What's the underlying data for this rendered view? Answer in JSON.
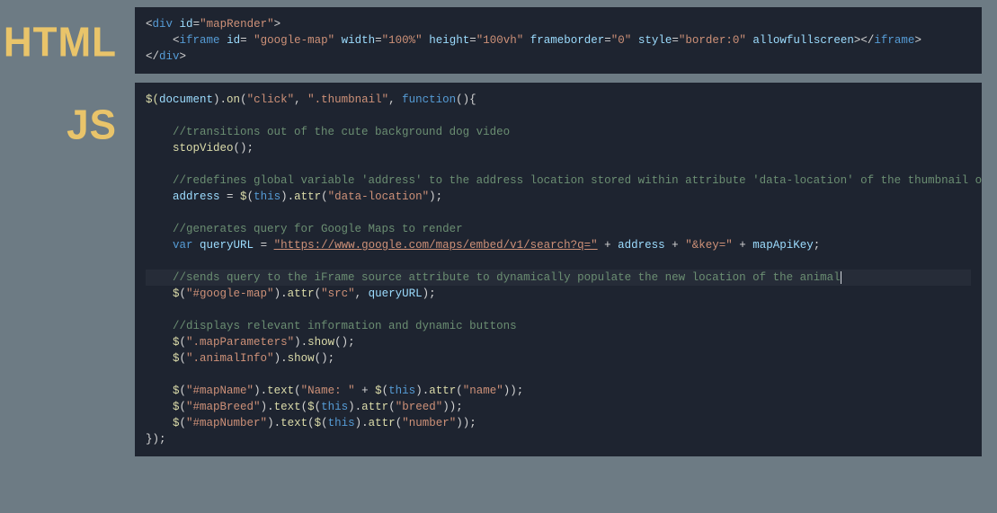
{
  "labels": {
    "html": "HTML",
    "js": "JS"
  },
  "html_code": {
    "l1": {
      "open": "<",
      "tag": "div",
      "sp": " ",
      "attr1": "id",
      "eq": "=",
      "val1": "\"mapRender\"",
      "close": ">"
    },
    "l2": {
      "indent": "    ",
      "open": "<",
      "tag": "iframe",
      "sp": " ",
      "a1": "id",
      "eq1": "= ",
      "v1": "\"google-map\"",
      "sp2": " ",
      "a2": "width",
      "eq2": "=",
      "v2": "\"100%\"",
      "sp3": " ",
      "a3": "height",
      "eq3": "=",
      "v3": "\"100vh\"",
      "sp4": " ",
      "a4": "frameborder",
      "eq4": "=",
      "v4": "\"0\"",
      "sp5": " ",
      "a5": "style",
      "eq5": "=",
      "v5": "\"border:0\"",
      "sp6": " ",
      "a6": "allowfullscreen",
      "closeself": "></",
      "tag2": "iframe",
      "close2": ">"
    },
    "l3": {
      "open": "</",
      "tag": "div",
      "close": ">"
    }
  },
  "js_code": {
    "l1": {
      "p1": "$(",
      "v": "document",
      "p2": ").",
      "f": "on",
      "p3": "(",
      "s1": "\"click\"",
      "c1": ", ",
      "s2": "\".thumbnail\"",
      "c2": ", ",
      "kw": "function",
      "p4": "(){"
    },
    "l3": {
      "indent": "    ",
      "c": "//transitions out of the cute background dog video"
    },
    "l4": {
      "indent": "    ",
      "f": "stopVideo",
      "p": "();"
    },
    "l6": {
      "indent": "    ",
      "c": "//redefines global variable 'address' to the address location stored within attribute 'data-location' of the thumbnail of the animal"
    },
    "l7": {
      "indent": "    ",
      "v": "address",
      "eq": " = ",
      "f1": "$",
      "p1": "(",
      "kw": "this",
      "p2": ").",
      "f2": "attr",
      "p3": "(",
      "s": "\"data-location\"",
      "p4": ");"
    },
    "l9": {
      "indent": "    ",
      "c": "//generates query for Google Maps to render"
    },
    "l10": {
      "indent": "    ",
      "kw": "var",
      "sp": " ",
      "v": "queryURL",
      "eq": " = ",
      "s1": "\"https://www.google.com/maps/embed/v1/search?q=\"",
      "p1": " + ",
      "v2": "address",
      "p2": " + ",
      "s2": "\"&key=\"",
      "p3": " + ",
      "v3": "mapApiKey",
      "end": ";"
    },
    "l12": {
      "indent": "    ",
      "c": "//sends query to the iFrame source attribute to dynamically populate the new location of the animal"
    },
    "l13": {
      "indent": "    ",
      "f1": "$",
      "p1": "(",
      "s1": "\"#google-map\"",
      "p2": ").",
      "f2": "attr",
      "p3": "(",
      "s2": "\"src\"",
      "c1": ", ",
      "v": "queryURL",
      "p4": ");"
    },
    "l15": {
      "indent": "    ",
      "c": "//displays relevant information and dynamic buttons"
    },
    "l16": {
      "indent": "    ",
      "f1": "$",
      "p1": "(",
      "s1": "\".mapParameters\"",
      "p2": ").",
      "f2": "show",
      "p3": "();"
    },
    "l17": {
      "indent": "    ",
      "f1": "$",
      "p1": "(",
      "s1": "\".animalInfo\"",
      "p2": ").",
      "f2": "show",
      "p3": "();"
    },
    "l19": {
      "indent": "    ",
      "f1": "$",
      "p1": "(",
      "s1": "\"#mapName\"",
      "p2": ").",
      "f2": "text",
      "p3": "(",
      "s2": "\"Name: \"",
      "p4": " + ",
      "f3": "$",
      "p5": "(",
      "kw": "this",
      "p6": ").",
      "f4": "attr",
      "p7": "(",
      "s3": "\"name\"",
      "p8": "));"
    },
    "l20": {
      "indent": "    ",
      "f1": "$",
      "p1": "(",
      "s1": "\"#mapBreed\"",
      "p2": ").",
      "f2": "text",
      "p3": "(",
      "f3": "$",
      "p5": "(",
      "kw": "this",
      "p6": ").",
      "f4": "attr",
      "p7": "(",
      "s3": "\"breed\"",
      "p8": "));"
    },
    "l21": {
      "indent": "    ",
      "f1": "$",
      "p1": "(",
      "s1": "\"#mapNumber\"",
      "p2": ").",
      "f2": "text",
      "p3": "(",
      "f3": "$",
      "p5": "(",
      "kw": "this",
      "p6": ").",
      "f4": "attr",
      "p7": "(",
      "s3": "\"number\"",
      "p8": "));"
    },
    "l22": {
      "p": "});"
    }
  }
}
